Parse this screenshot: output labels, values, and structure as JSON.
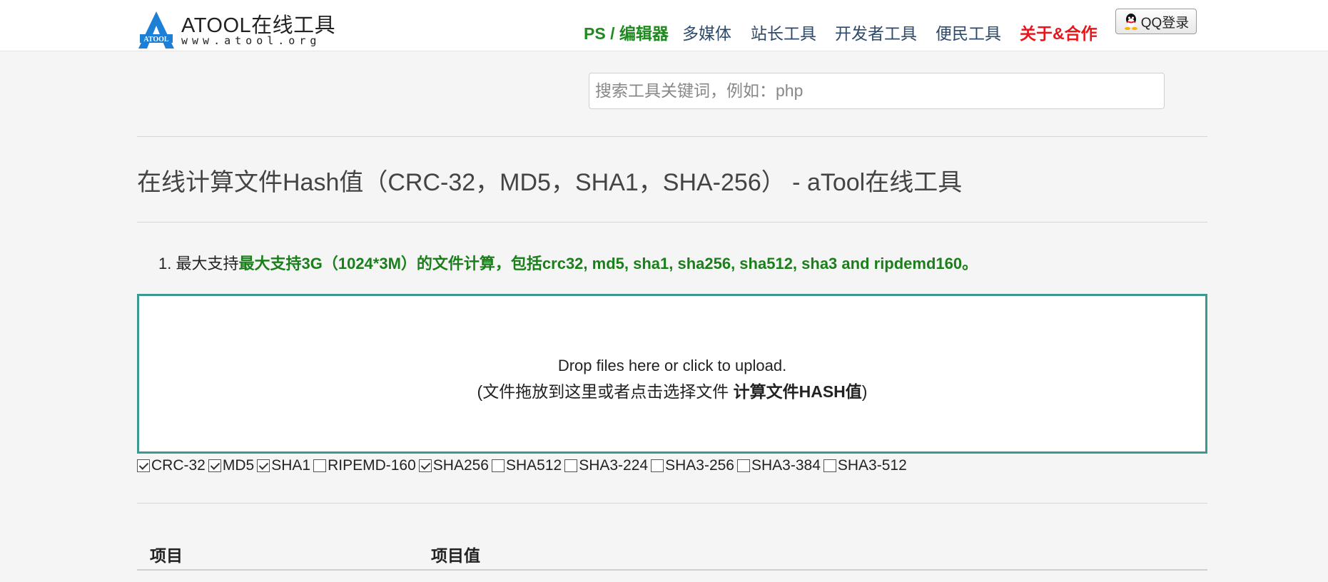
{
  "brand": {
    "name": "ATOOL在线工具",
    "url": "www.atool.org",
    "logo_letters": "ATOOL"
  },
  "nav": {
    "items": [
      {
        "label": "PS / 编辑器"
      },
      {
        "label": "多媒体"
      },
      {
        "label": "站长工具"
      },
      {
        "label": "开发者工具"
      },
      {
        "label": "便民工具"
      },
      {
        "label": "关于&合作"
      }
    ],
    "qq_login": "QQ登录"
  },
  "search": {
    "placeholder": "搜索工具关键词，例如：php",
    "value": ""
  },
  "page": {
    "title": "在线计算文件Hash值（CRC-32，MD5，SHA1，SHA-256） - aTool在线工具"
  },
  "note": {
    "number": "1.",
    "prefix": "最大支持",
    "highlight": "最大支持3G（1024*3M）的文件计算，包括crc32, md5, sha1, sha256, sha512, sha3 and ripdemd160。"
  },
  "dropzone": {
    "line1": "Drop files here or click to upload.",
    "line2_open": "(文件拖放到这里或者点击选择文件 ",
    "line2_bold": "计算文件HASH值",
    "line2_close": ")"
  },
  "algorithms": [
    {
      "label": "CRC-32",
      "checked": true
    },
    {
      "label": "MD5",
      "checked": true
    },
    {
      "label": "SHA1",
      "checked": true
    },
    {
      "label": "RIPEMD-160",
      "checked": false
    },
    {
      "label": "SHA256",
      "checked": true
    },
    {
      "label": "SHA512",
      "checked": false
    },
    {
      "label": "SHA3-224",
      "checked": false
    },
    {
      "label": "SHA3-256",
      "checked": false
    },
    {
      "label": "SHA3-384",
      "checked": false
    },
    {
      "label": "SHA3-512",
      "checked": false
    }
  ],
  "table": {
    "headers": [
      "项目",
      "项目值"
    ]
  },
  "colors": {
    "nav_ps": "#1f8a1f",
    "nav_about": "#e8161b",
    "note_highlight": "#1a7f1a",
    "dropzone_border": "#3a9a8f",
    "logo_blue": "#1d7fd6"
  }
}
